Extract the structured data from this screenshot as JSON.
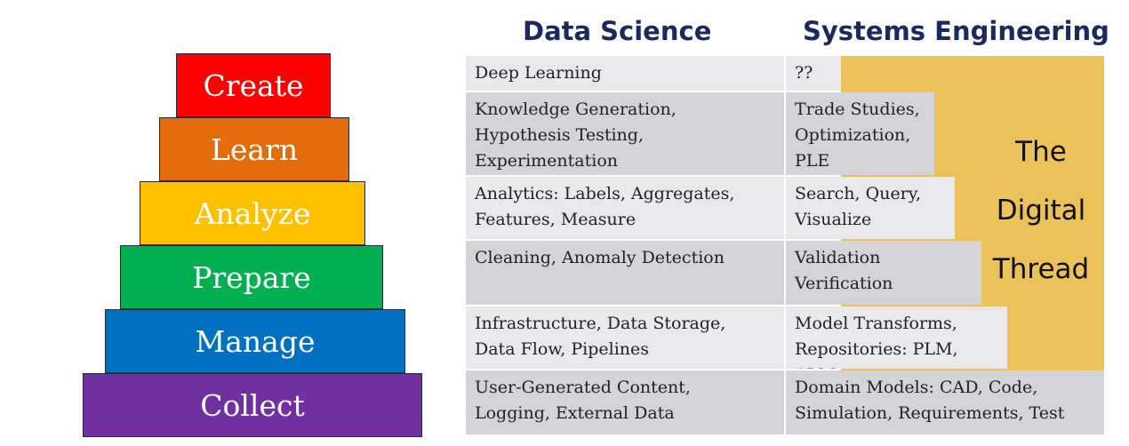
{
  "pyramid": [
    "Create",
    "Learn",
    "Analyze",
    "Prepare",
    "Manage",
    "Collect"
  ],
  "colors": {
    "create": "#ff0000",
    "learn": "#e46c0a",
    "analyze": "#ffc000",
    "prepare": "#00b050",
    "manage": "#0070c0",
    "collect": "#7030a0",
    "thread": "#ebc15a",
    "header": "#1a2a5e"
  },
  "headers": {
    "data_science": "Data Science",
    "systems_engineering": "Systems Engineering"
  },
  "thread_label": "The\nDigital\nThread",
  "rows": [
    {
      "ds": "Deep Learning",
      "se": "??"
    },
    {
      "ds": "Knowledge Generation,\nHypothesis Testing,\nExperimentation",
      "se": "Trade Studies,\nOptimization,\nPLE"
    },
    {
      "ds": "Analytics: Labels, Aggregates,\nFeatures, Measure",
      "se": "Search, Query,\nVisualize"
    },
    {
      "ds": "Cleaning, Anomaly Detection",
      "se": "Validation\nVerification"
    },
    {
      "ds": "Infrastructure, Data Storage,\nData Flow, Pipelines",
      "se": "Model Transforms,\nRepositories: PLM, ALM, …"
    },
    {
      "ds": "User-Generated Content,\nLogging, External Data",
      "se": "Domain Models: CAD, Code,\nSimulation, Requirements, Test"
    }
  ]
}
